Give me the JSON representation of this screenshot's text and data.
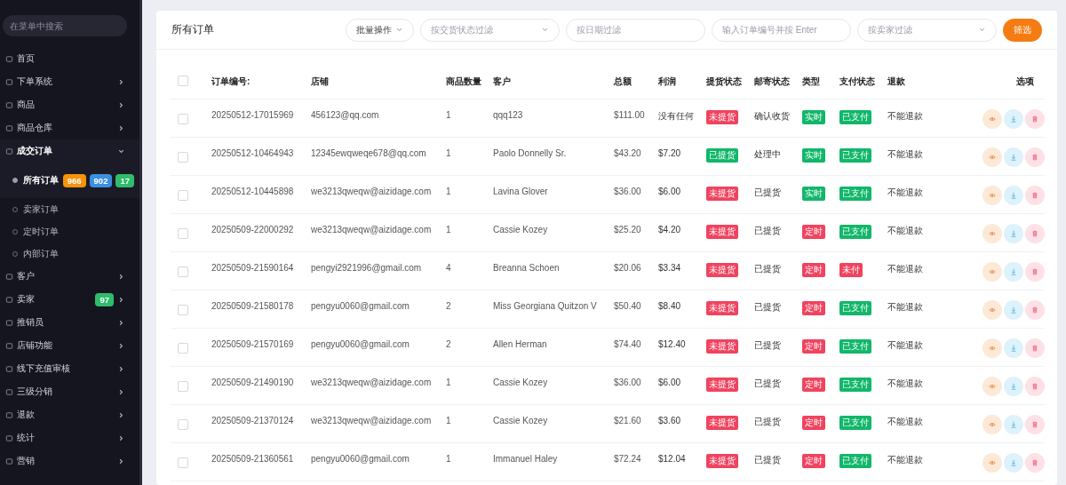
{
  "sidebar": {
    "search": {
      "placeholder": "在菜单中搜索"
    },
    "items": [
      {
        "label": "首页",
        "chevron": false,
        "expanded": false
      },
      {
        "label": "下单系统",
        "chevron": true,
        "expanded": false
      },
      {
        "label": "商品",
        "chevron": true,
        "expanded": false
      },
      {
        "label": "商品仓库",
        "chevron": true,
        "expanded": false
      },
      {
        "label": "成交订单",
        "chevron": true,
        "expanded": true,
        "children": [
          {
            "label": "所有订单",
            "selected": true,
            "badges": [
              {
                "text": "966",
                "color": "#f7930b"
              },
              {
                "text": "902",
                "color": "#3b8fe0"
              },
              {
                "text": "17",
                "color": "#2ebd6b"
              }
            ]
          },
          {
            "label": "卖家订单",
            "selected": false
          },
          {
            "label": "定时订单",
            "selected": false
          },
          {
            "label": "内部订单",
            "selected": false
          }
        ]
      },
      {
        "label": "客户",
        "chevron": true,
        "expanded": false
      },
      {
        "label": "卖家",
        "chevron": true,
        "expanded": false,
        "badges": [
          {
            "text": "97",
            "color": "#2ebd6b"
          }
        ]
      },
      {
        "label": "推销员",
        "chevron": true,
        "expanded": false
      },
      {
        "label": "店铺功能",
        "chevron": true,
        "expanded": false
      },
      {
        "label": "线下充值审核",
        "chevron": true,
        "expanded": false
      },
      {
        "label": "三级分销",
        "chevron": true,
        "expanded": false
      },
      {
        "label": "退款",
        "chevron": true,
        "expanded": false
      },
      {
        "label": "统计",
        "chevron": true,
        "expanded": false
      },
      {
        "label": "营销",
        "chevron": true,
        "expanded": false
      }
    ]
  },
  "toolbar": {
    "title": "所有订单",
    "bulk_action": "批量操作",
    "status_filter": {
      "placeholder": "按交货状态过滤"
    },
    "date_filter": {
      "placeholder": "按日期过滤"
    },
    "order_search": {
      "placeholder": "输入订单编号并按 Enter"
    },
    "seller_filter": {
      "placeholder": "按卖家过滤"
    },
    "filter_button": "筛选"
  },
  "table": {
    "select_all": {
      "checked": false
    },
    "columns": [
      "订单编号:",
      "店铺",
      "商品数量",
      "客户",
      "总额",
      "利润",
      "提货状态",
      "邮寄状态",
      "类型",
      "支付状态",
      "退款",
      "选项"
    ],
    "rows": [
      {
        "checked": false,
        "order_no": "20250512-17015969",
        "shop": "456123@qq.com",
        "qty": "1",
        "customer": "qqq123",
        "total": "$111.00",
        "profit": "没有任何",
        "pickup": {
          "text": "未提货",
          "color": "#f0435f"
        },
        "shipping": "确认收货",
        "type": {
          "text": "实时",
          "color": "#12b76a"
        },
        "payment": {
          "text": "已支付",
          "color": "#12b76a"
        },
        "refund": "不能退款"
      },
      {
        "checked": false,
        "order_no": "20250512-10464943",
        "shop": "12345ewqweqe678@qq.com",
        "qty": "1",
        "customer": "Paolo Donnelly Sr.",
        "total": "$43.20",
        "profit": "$7.20",
        "pickup": {
          "text": "已提货",
          "color": "#12b76a"
        },
        "shipping": "处理中",
        "type": {
          "text": "实时",
          "color": "#12b76a"
        },
        "payment": {
          "text": "已支付",
          "color": "#12b76a"
        },
        "refund": "不能退款"
      },
      {
        "checked": false,
        "order_no": "20250512-10445898",
        "shop": "we3213qweqw@aizidage.com",
        "qty": "1",
        "customer": "Lavina Glover",
        "total": "$36.00",
        "profit": "$6.00",
        "pickup": {
          "text": "未提货",
          "color": "#f0435f"
        },
        "shipping": "已提货",
        "type": {
          "text": "实时",
          "color": "#12b76a"
        },
        "payment": {
          "text": "已支付",
          "color": "#12b76a"
        },
        "refund": "不能退款"
      },
      {
        "checked": false,
        "order_no": "20250509-22000292",
        "shop": "we3213qweqw@aizidage.com",
        "qty": "1",
        "customer": "Cassie Kozey",
        "total": "$25.20",
        "profit": "$4.20",
        "pickup": {
          "text": "未提货",
          "color": "#f0435f"
        },
        "shipping": "已提货",
        "type": {
          "text": "定时",
          "color": "#f0435f"
        },
        "payment": {
          "text": "已支付",
          "color": "#12b76a"
        },
        "refund": "不能退款"
      },
      {
        "checked": false,
        "order_no": "20250509-21590164",
        "shop": "pengyi2921996@gmail.com",
        "qty": "4",
        "customer": "Breanna Schoen",
        "total": "$20.06",
        "profit": "$3.34",
        "pickup": {
          "text": "未提货",
          "color": "#f0435f"
        },
        "shipping": "已提货",
        "type": {
          "text": "定时",
          "color": "#f0435f"
        },
        "payment": {
          "text": "未付",
          "color": "#f0435f"
        },
        "refund": "不能退款"
      },
      {
        "checked": false,
        "order_no": "20250509-21580178",
        "shop": "pengyu0060@gmail.com",
        "qty": "2",
        "customer": "Miss Georgiana Quitzon V",
        "total": "$50.40",
        "profit": "$8.40",
        "pickup": {
          "text": "未提货",
          "color": "#f0435f"
        },
        "shipping": "已提货",
        "type": {
          "text": "定时",
          "color": "#f0435f"
        },
        "payment": {
          "text": "已支付",
          "color": "#12b76a"
        },
        "refund": "不能退款"
      },
      {
        "checked": false,
        "order_no": "20250509-21570169",
        "shop": "pengyu0060@gmail.com",
        "qty": "2",
        "customer": "Allen Herman",
        "total": "$74.40",
        "profit": "$12.40",
        "pickup": {
          "text": "未提货",
          "color": "#f0435f"
        },
        "shipping": "已提货",
        "type": {
          "text": "定时",
          "color": "#f0435f"
        },
        "payment": {
          "text": "已支付",
          "color": "#12b76a"
        },
        "refund": "不能退款"
      },
      {
        "checked": false,
        "order_no": "20250509-21490190",
        "shop": "we3213qweqw@aizidage.com",
        "qty": "1",
        "customer": "Cassie Kozey",
        "total": "$36.00",
        "profit": "$6.00",
        "pickup": {
          "text": "未提货",
          "color": "#f0435f"
        },
        "shipping": "已提货",
        "type": {
          "text": "定时",
          "color": "#f0435f"
        },
        "payment": {
          "text": "已支付",
          "color": "#12b76a"
        },
        "refund": "不能退款"
      },
      {
        "checked": false,
        "order_no": "20250509-21370124",
        "shop": "we3213qweqw@aizidage.com",
        "qty": "1",
        "customer": "Cassie Kozey",
        "total": "$21.60",
        "profit": "$3.60",
        "pickup": {
          "text": "未提货",
          "color": "#f0435f"
        },
        "shipping": "已提货",
        "type": {
          "text": "定时",
          "color": "#f0435f"
        },
        "payment": {
          "text": "已支付",
          "color": "#12b76a"
        },
        "refund": "不能退款"
      },
      {
        "checked": false,
        "order_no": "20250509-21360561",
        "shop": "pengyu0060@gmail.com",
        "qty": "1",
        "customer": "Immanuel Haley",
        "total": "$72.24",
        "profit": "$12.04",
        "pickup": {
          "text": "未提货",
          "color": "#f0435f"
        },
        "shipping": "已提货",
        "type": {
          "text": "定时",
          "color": "#f0435f"
        },
        "payment": {
          "text": "已支付",
          "color": "#12b76a"
        },
        "refund": "不能退款"
      }
    ]
  }
}
